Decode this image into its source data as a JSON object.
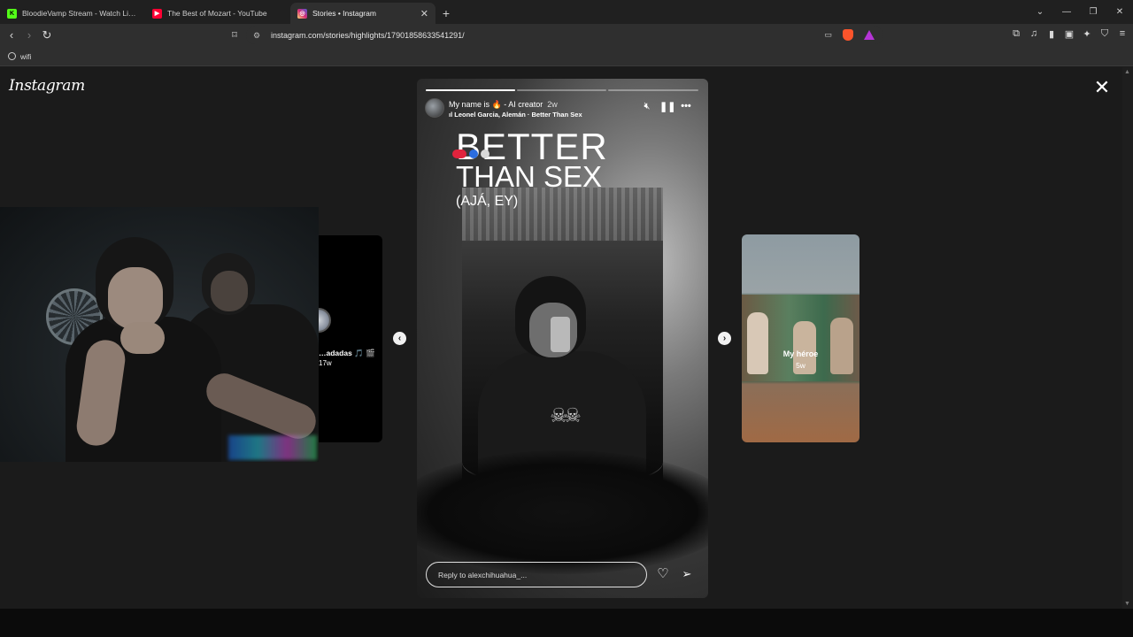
{
  "tabs": [
    {
      "title": "BloodieVamp Stream - Watch Live on",
      "favicon_color": "#53fc18",
      "favicon_letter": "K"
    },
    {
      "title": "The Best of Mozart - YouTube",
      "favicon_color": "#ff0033",
      "favicon_letter": "▶"
    },
    {
      "title": "Stories • Instagram",
      "favicon_color": "#d62976",
      "favicon_letter": "◎"
    }
  ],
  "address_bar": {
    "url": "instagram.com/stories/highlights/17901858633541291/"
  },
  "bookmarks": [
    {
      "label": "wifi"
    }
  ],
  "instagram": {
    "logo": "Instagram",
    "prev_story": {
      "name": "…adadas 🎵 🎬",
      "time": "17w"
    },
    "next_story": {
      "name": "My héroe",
      "time": "5w"
    },
    "story": {
      "username": "My name is 🔥 - AI creator",
      "age": "2w",
      "music": "Leonel Garcia, Alemán · Better Than Sex",
      "text_line1": "BETTER",
      "text_line2": "THAN SEX",
      "text_line3": "(AJÁ, EY)",
      "progress_segments": [
        1.0,
        0.0,
        0.0
      ],
      "reply_placeholder": "Reply to alexchihuahua_..."
    }
  },
  "colors": {
    "page_bg": "#1b1b1b",
    "brave_orange": "#fb542b",
    "rewards_purple": "#b634d7"
  }
}
